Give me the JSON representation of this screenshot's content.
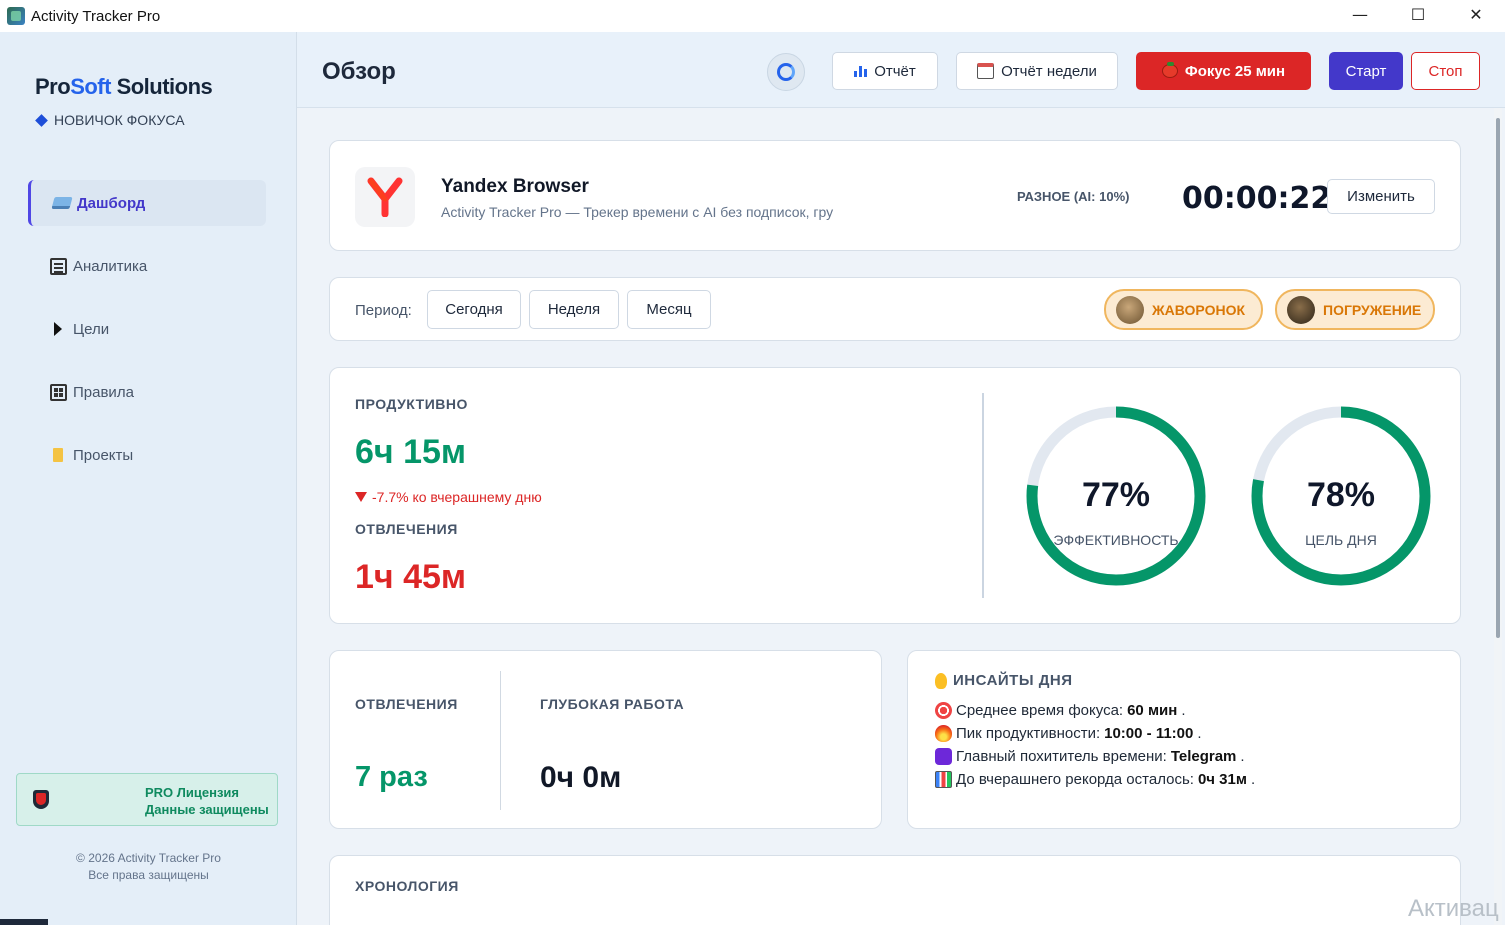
{
  "window": {
    "title": "Activity Tracker Pro",
    "min": "—",
    "max": "☐",
    "close": "✕"
  },
  "sidebar": {
    "brand_pro": "Pro",
    "brand_soft": "Soft",
    "brand_rest": " Solutions",
    "rank": "НОВИЧОК ФОКУСА",
    "items": [
      {
        "label": "Дашборд",
        "icon": "laptop-icon"
      },
      {
        "label": "Аналитика",
        "icon": "document-icon"
      },
      {
        "label": "Цели",
        "icon": "triangle-icon"
      },
      {
        "label": "Правила",
        "icon": "grid-icon"
      },
      {
        "label": "Проекты",
        "icon": "folder-icon"
      }
    ],
    "license_line1": "PRO Лицензия",
    "license_line2": "Данные защищены",
    "copyright_line1": "© 2026 Activity Tracker Pro",
    "copyright_line2": "Все права защищены"
  },
  "header": {
    "title": "Обзор",
    "report": "Отчёт",
    "week_report": "Отчёт недели",
    "focus": "Фокус 25 мин",
    "start": "Старт",
    "stop": "Стоп"
  },
  "current_app": {
    "name": "Yandex Browser",
    "description": "Activity Tracker Pro — Трекер времени с AI без подписок, гру",
    "category": "РАЗНОЕ (AI: 10%)",
    "timer": "00:00:22",
    "edit": "Изменить"
  },
  "period": {
    "label": "Период:",
    "options": [
      "Сегодня",
      "Неделя",
      "Месяц"
    ],
    "badges": [
      "ЖАВОРОНОК",
      "ПОГРУЖЕНИЕ"
    ]
  },
  "stats": {
    "productive_label": "ПРОДУКТИВНО",
    "productive_value": "6ч 15м",
    "delta": "-7.7% ко вчерашнему дню",
    "distraction_label": "ОТВЛЕЧЕНИЯ",
    "distraction_value": "1ч 45м",
    "efficiency_value": "77%",
    "efficiency_label": "ЭФФЕКТИВНОСТЬ",
    "efficiency_fraction": 0.77,
    "goal_value": "78%",
    "goal_label": "ЦЕЛЬ ДНЯ",
    "goal_fraction": 0.78
  },
  "counts": {
    "distractions_label": "ОТВЛЕЧЕНИЯ",
    "distractions_value": "7 раз",
    "deep_label": "ГЛУБОКАЯ РАБОТА",
    "deep_value": "0ч 0м"
  },
  "insights": {
    "title": "ИНСАЙТЫ ДНЯ",
    "items": [
      {
        "text": "Среднее время фокуса: ",
        "bold": "60 мин",
        "end": "."
      },
      {
        "text": "Пик продуктивности: ",
        "bold": "10:00 - 11:00",
        "end": "."
      },
      {
        "text": "Главный похититель времени: ",
        "bold": "Telegram",
        "end": "."
      },
      {
        "text": "До вчерашнего рекорда осталось: ",
        "bold": "0ч 31м",
        "end": "."
      }
    ]
  },
  "timeline": {
    "title": "ХРОНОЛОГИЯ"
  },
  "watermark": "Активац",
  "colors": {
    "accent": "#4338ca",
    "green": "#059669",
    "red": "#dc2626",
    "ring_track": "#e2e8f0"
  }
}
